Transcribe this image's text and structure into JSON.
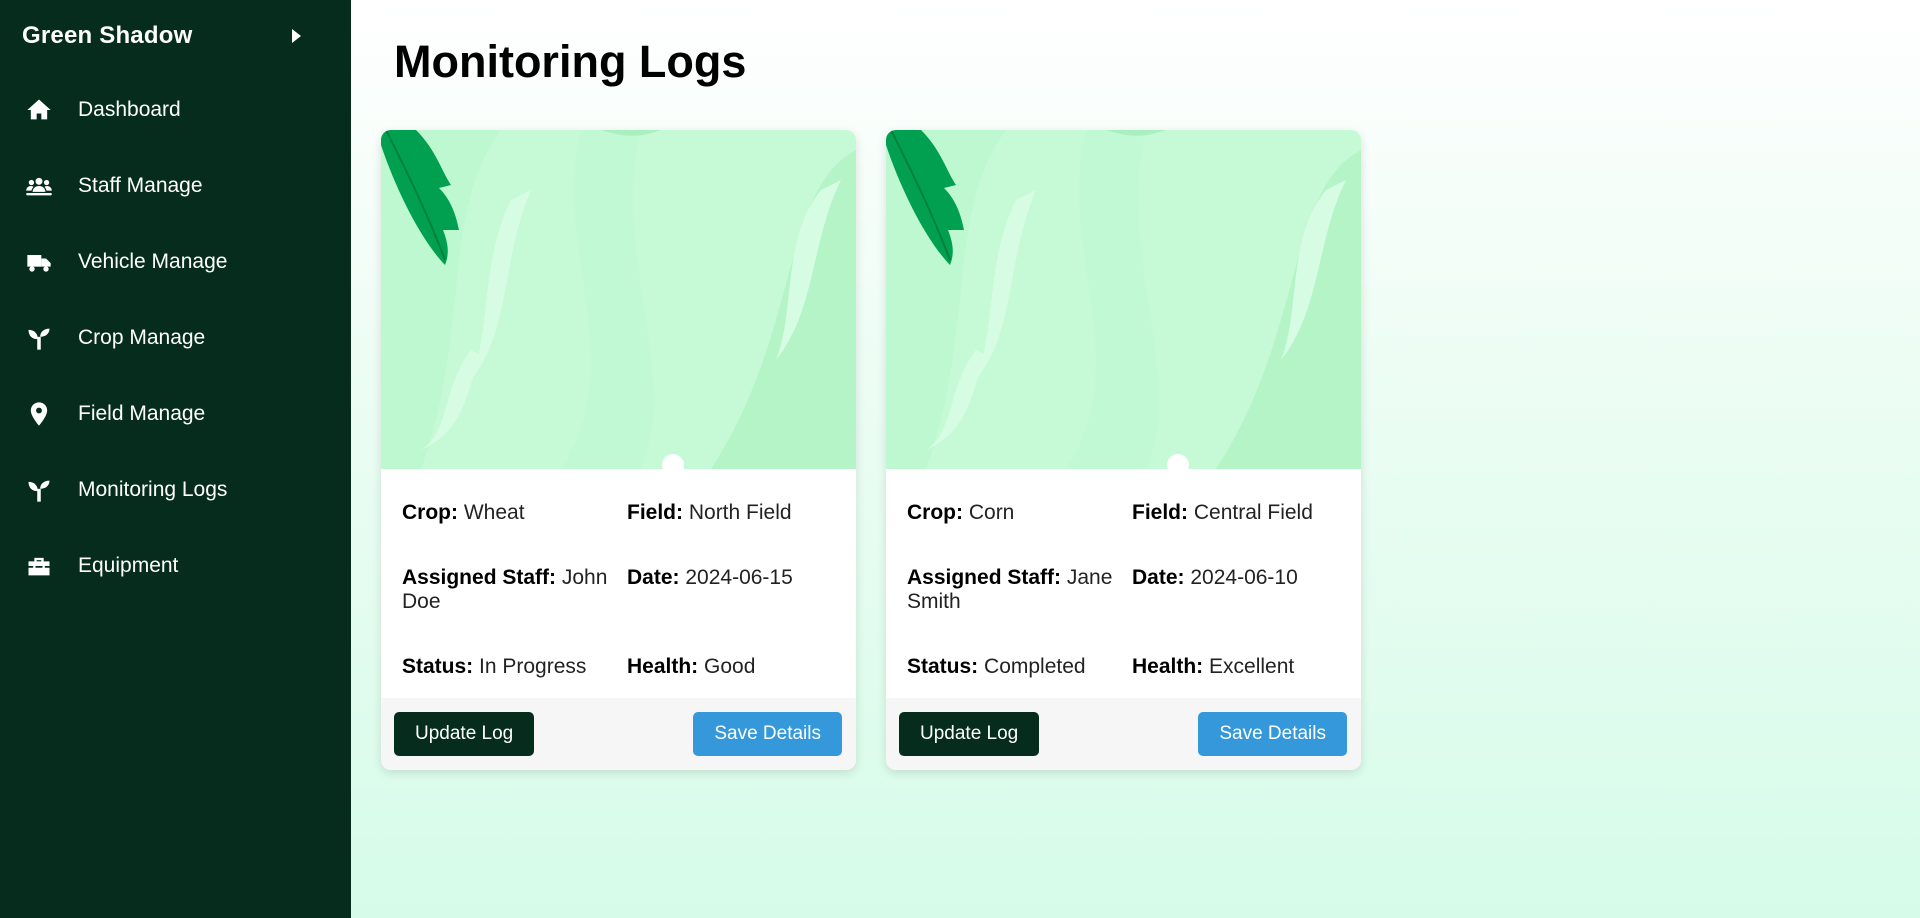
{
  "sidebar": {
    "brand": "Green Shadow",
    "items": [
      {
        "label": "Dashboard",
        "icon": "home-icon"
      },
      {
        "label": "Staff Manage",
        "icon": "users-icon"
      },
      {
        "label": "Vehicle Manage",
        "icon": "truck-icon"
      },
      {
        "label": "Crop Manage",
        "icon": "seedling-icon"
      },
      {
        "label": "Field Manage",
        "icon": "map-pin-icon"
      },
      {
        "label": "Monitoring Logs",
        "icon": "seedling-icon"
      },
      {
        "label": "Equipment",
        "icon": "toolbox-icon"
      }
    ]
  },
  "main": {
    "title": "Monitoring Logs",
    "labels": {
      "crop": "Crop:",
      "field": "Field:",
      "staff": "Assigned Staff:",
      "date": "Date:",
      "status": "Status:",
      "health": "Health:"
    },
    "cards": [
      {
        "crop": "Wheat",
        "field": "North Field",
        "staff": "John Doe",
        "date": "2024-06-15",
        "status": "In Progress",
        "health": "Good",
        "update_label": "Update Log",
        "save_label": "Save Details"
      },
      {
        "crop": "Corn",
        "field": "Central Field",
        "staff": "Jane Smith",
        "date": "2024-06-10",
        "status": "Completed",
        "health": "Excellent",
        "update_label": "Update Log",
        "save_label": "Save Details"
      }
    ]
  },
  "colors": {
    "sidebar_bg": "#052c1c",
    "primary_dark": "#052c1c",
    "accent_blue": "#3498db",
    "leaf_green": "#00a050"
  }
}
